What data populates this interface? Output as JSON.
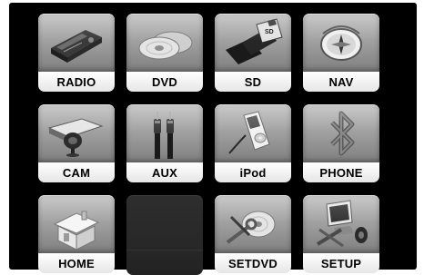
{
  "menu": {
    "tiles": [
      {
        "label": "RADIO",
        "icon": "radio-icon"
      },
      {
        "label": "DVD",
        "icon": "disc-icon"
      },
      {
        "label": "SD",
        "icon": "sd-card-icon"
      },
      {
        "label": "NAV",
        "icon": "compass-icon"
      },
      {
        "label": "CAM",
        "icon": "camera-icon"
      },
      {
        "label": "AUX",
        "icon": "rca-cable-icon"
      },
      {
        "label": "iPod",
        "icon": "ipod-icon"
      },
      {
        "label": "PHONE",
        "icon": "bluetooth-icon"
      },
      {
        "label": "HOME",
        "icon": "house-icon"
      },
      {
        "label": "",
        "icon": ""
      },
      {
        "label": "SETDVD",
        "icon": "disc-wrench-icon"
      },
      {
        "label": "SETUP",
        "icon": "computer-tools-icon"
      }
    ]
  }
}
